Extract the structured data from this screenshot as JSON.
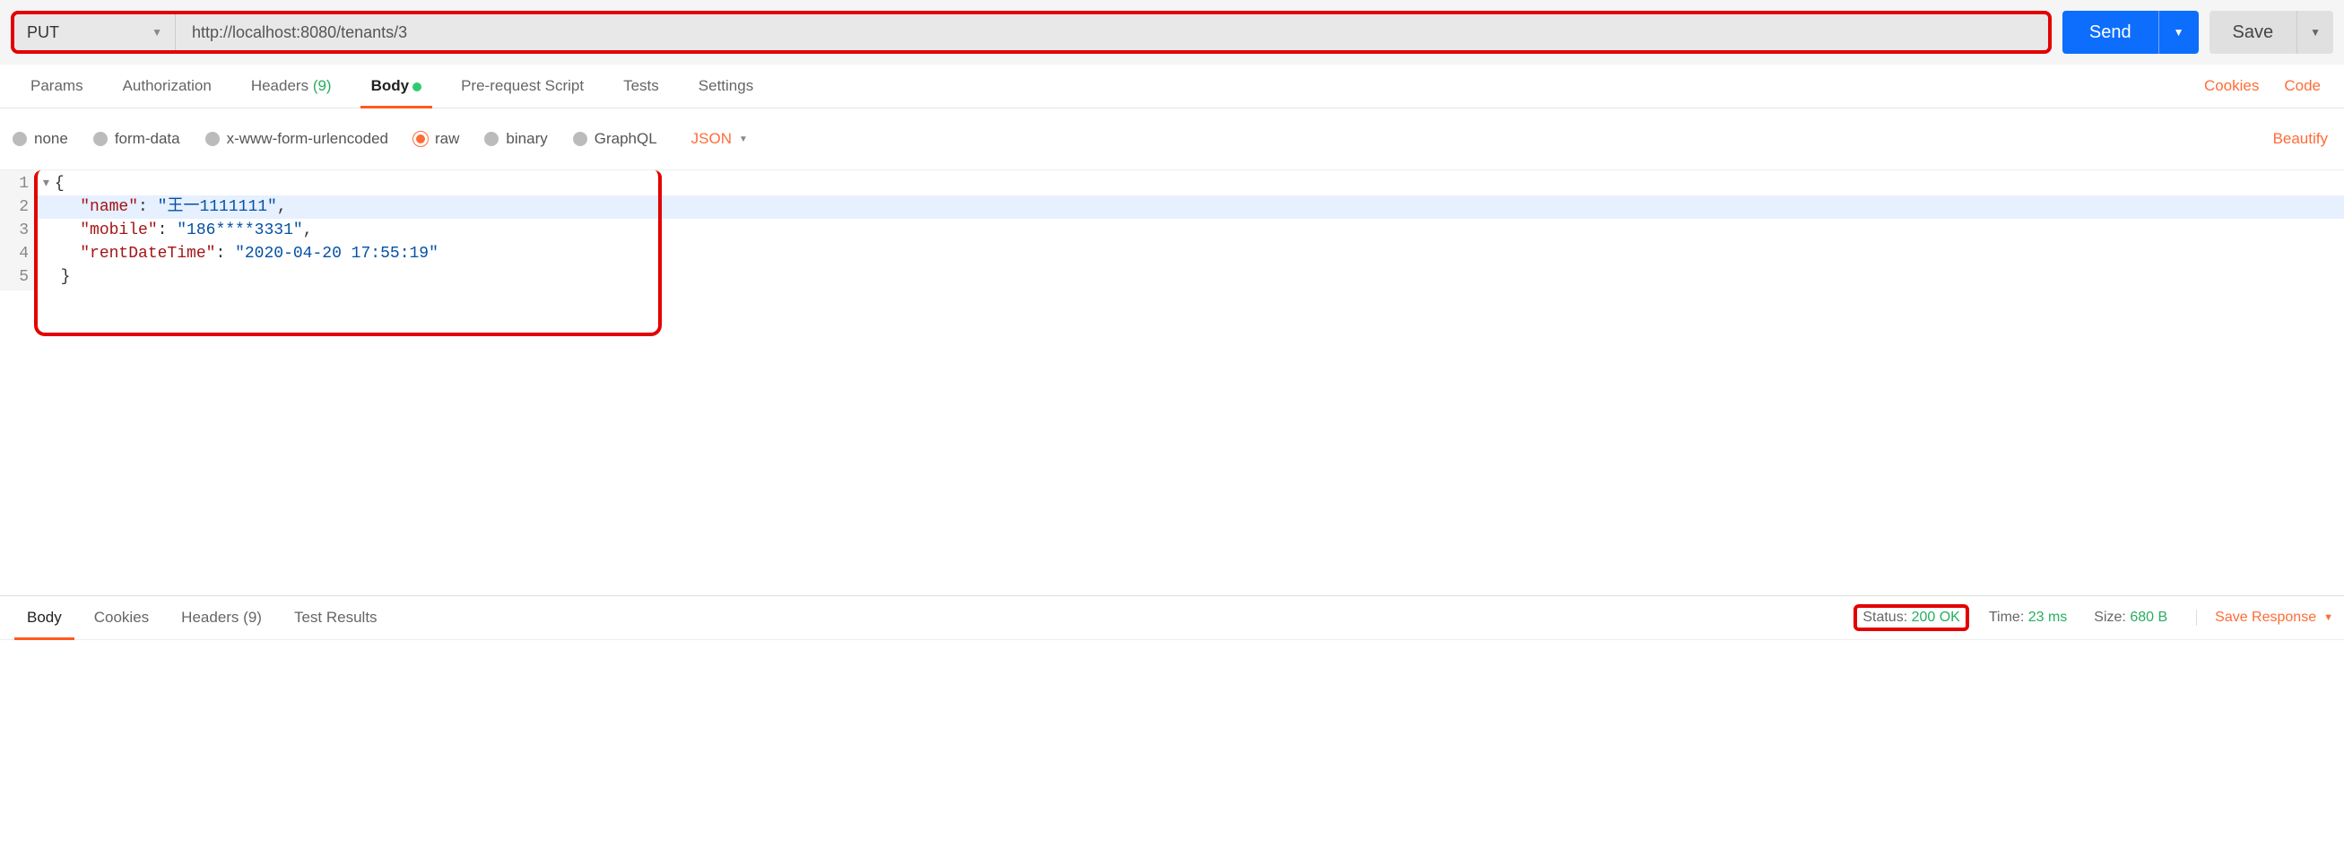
{
  "request": {
    "method": "PUT",
    "url": "http://localhost:8080/tenants/3",
    "send_label": "Send",
    "save_label": "Save"
  },
  "tabs": {
    "params": "Params",
    "authorization": "Authorization",
    "headers": "Headers",
    "headers_count": "(9)",
    "body": "Body",
    "prerequest": "Pre-request Script",
    "tests": "Tests",
    "settings": "Settings",
    "cookies_link": "Cookies",
    "code_link": "Code"
  },
  "body_types": {
    "none": "none",
    "formdata": "form-data",
    "urlencoded": "x-www-form-urlencoded",
    "raw": "raw",
    "binary": "binary",
    "graphql": "GraphQL",
    "format": "JSON",
    "beautify": "Beautify"
  },
  "editor": {
    "lines": [
      "1",
      "2",
      "3",
      "4",
      "5"
    ],
    "json": {
      "name_key": "\"name\"",
      "name_val": "\"王一1111111\"",
      "mobile_key": "\"mobile\"",
      "mobile_val": "\"186****3331\"",
      "rent_key": "\"rentDateTime\"",
      "rent_val": "\"2020-04-20 17:55:19\""
    }
  },
  "response_tabs": {
    "body": "Body",
    "cookies": "Cookies",
    "headers": "Headers",
    "headers_count": "(9)",
    "test_results": "Test Results"
  },
  "response_stats": {
    "status_label": "Status:",
    "status_value": "200 OK",
    "time_label": "Time:",
    "time_value": "23 ms",
    "size_label": "Size:",
    "size_value": "680 B",
    "save_response": "Save Response"
  }
}
